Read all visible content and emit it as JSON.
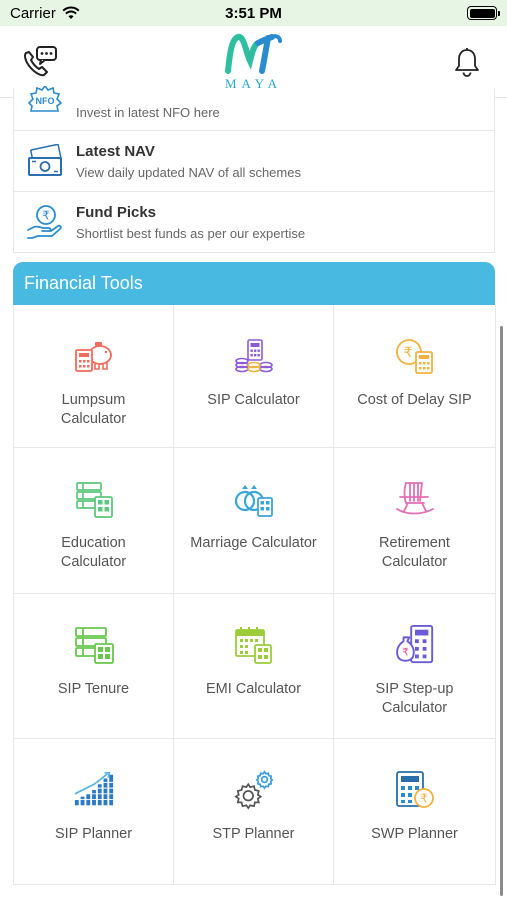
{
  "status_bar": {
    "carrier": "Carrier",
    "time": "3:51 PM",
    "battery_level": 1.0
  },
  "header": {
    "logo_text": "MAYA",
    "left_icon": "chat-phone-icon",
    "right_icon": "bell-icon"
  },
  "menu": [
    {
      "title": "",
      "subtitle": "Invest in latest NFO here",
      "icon": "nfo-icon"
    },
    {
      "title": "Latest NAV",
      "subtitle": "View daily updated NAV of all schemes",
      "icon": "banknote-icon"
    },
    {
      "title": "Fund Picks",
      "subtitle": "Shortlist best funds as per our expertise",
      "icon": "rupee-hand-icon"
    }
  ],
  "tools": {
    "title": "Financial Tools",
    "items": [
      {
        "label": "Lumpsum Calculator",
        "icon": "piggy-bank-calculator-icon",
        "color": "#f26b5b"
      },
      {
        "label": "SIP Calculator",
        "icon": "coins-calculator-icon",
        "color": "#8e5bd6"
      },
      {
        "label": "Cost of Delay SIP",
        "icon": "rupee-coin-calculator-icon",
        "color": "#f2b23e"
      },
      {
        "label": "Education Calculator",
        "icon": "books-calculator-icon",
        "color": "#5cc87d"
      },
      {
        "label": "Marriage Calculator",
        "icon": "rings-calculator-icon",
        "color": "#3aa6d8"
      },
      {
        "label": "Retirement Calculator",
        "icon": "rocking-chair-icon",
        "color": "#e26fb5"
      },
      {
        "label": "SIP Tenure",
        "icon": "books-calculator-icon",
        "color": "#68c74e"
      },
      {
        "label": "EMI Calculator",
        "icon": "calendar-calculator-icon",
        "color": "#9ccc3a"
      },
      {
        "label": "SIP Step-up Calculator",
        "icon": "rupee-bag-calculator-icon",
        "color": "#6b5bd6"
      },
      {
        "label": "SIP Planner",
        "icon": "bar-growth-icon",
        "color": "#2a7ac8"
      },
      {
        "label": "STP Planner",
        "icon": "gears-icon",
        "color": "#3a9be0"
      },
      {
        "label": "SWP Planner",
        "icon": "calculator-rupee-icon",
        "color": "#2a8ccf"
      }
    ]
  },
  "colors": {
    "accent": "#48b9e0",
    "status_bar_bg": "#e7f5e4",
    "logo": "#2aa7c8"
  }
}
